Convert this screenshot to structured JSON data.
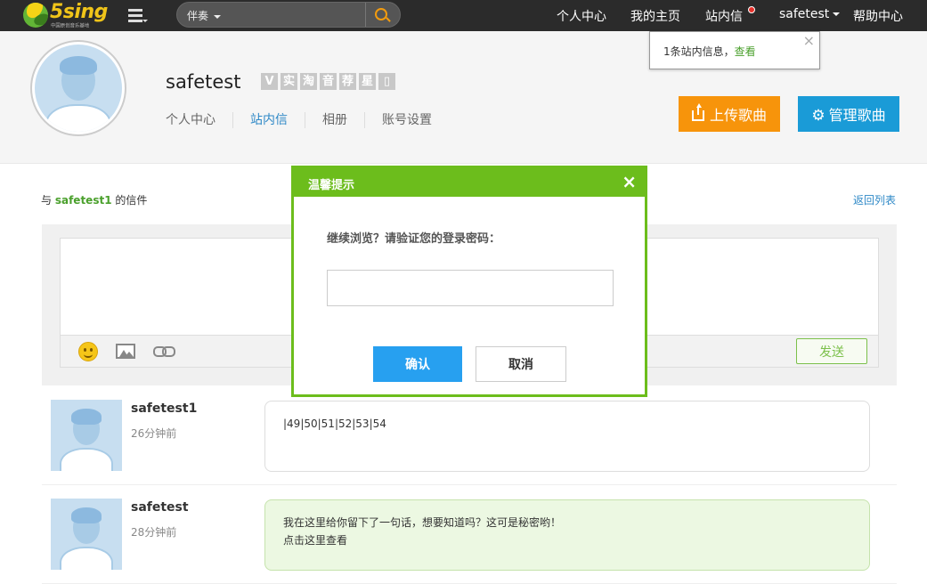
{
  "logo": {
    "text": "5sing",
    "sub": "中国原创音乐基地"
  },
  "search": {
    "category": "伴奏",
    "placeholder": ""
  },
  "nav": {
    "personal_center": "个人中心",
    "my_homepage": "我的主页",
    "site_messages": "站内信",
    "user": "safetest",
    "help_center": "帮助中心"
  },
  "notification": {
    "text": "1条站内信息，",
    "link": "查看",
    "close": "×"
  },
  "profile": {
    "username": "safetest",
    "badges": [
      "V",
      "实",
      "淘",
      "音",
      "荐",
      "星",
      "▯"
    ],
    "tabs": [
      {
        "label": "个人中心",
        "active": false
      },
      {
        "label": "站内信",
        "active": true
      },
      {
        "label": "相册",
        "active": false
      },
      {
        "label": "账号设置",
        "active": false
      }
    ],
    "upload_label": "上传歌曲",
    "manage_label": "管理歌曲"
  },
  "letters": {
    "prefix": "与",
    "partner": "safetest1",
    "suffix": "的信件",
    "back_label": "返回列表",
    "send_label": "发送",
    "messages": [
      {
        "name": "safetest1",
        "time": "26分钟前",
        "text": "|49|50|51|52|53|54",
        "link": ""
      },
      {
        "name": "safetest",
        "time": "28分钟前",
        "text": "我在这里给你留下了一句话，想要知道吗？这可是秘密哟！",
        "link": "点击这里查看"
      }
    ]
  },
  "modal": {
    "title": "温馨提示",
    "close": "×",
    "prompt": "继续浏览？请验证您的登录密码：",
    "confirm_label": "确认",
    "cancel_label": "取消"
  },
  "colors": {
    "brand_green": "#6cbd1c",
    "upload_orange": "#f7940b",
    "manage_blue": "#1a9bd7",
    "link_blue": "#2f89c7"
  }
}
